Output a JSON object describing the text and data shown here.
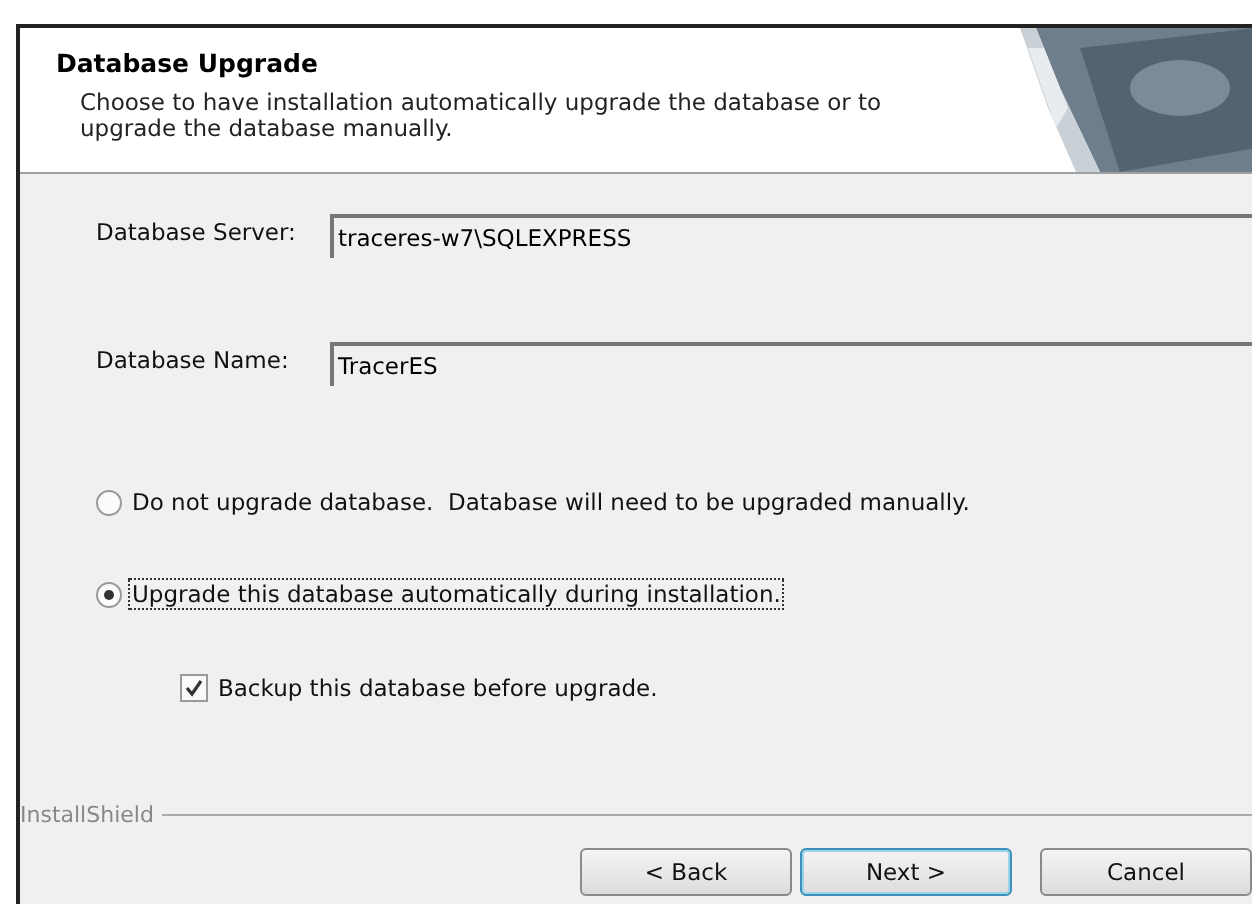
{
  "header": {
    "title": "Database Upgrade",
    "description": "Choose to have installation automatically upgrade the database or to upgrade the database manually."
  },
  "fields": [
    {
      "label": "Database Server:",
      "value": "traceres-w7\\SQLEXPRESS"
    },
    {
      "label": "Database Name:",
      "value": "TracerES"
    }
  ],
  "options": [
    {
      "label": "Do not upgrade database.  Database will need to be upgraded manually.",
      "selected": false,
      "focused": false
    },
    {
      "label": "Upgrade this database automatically during installation.",
      "selected": true,
      "focused": true
    }
  ],
  "backup": {
    "label": "Backup this database before upgrade.",
    "checked": true
  },
  "footer": {
    "brand": "InstallShield"
  },
  "buttons": [
    {
      "label": "< Back",
      "default": false
    },
    {
      "label": "Next >",
      "default": true
    },
    {
      "label": "Cancel",
      "default": false
    }
  ]
}
